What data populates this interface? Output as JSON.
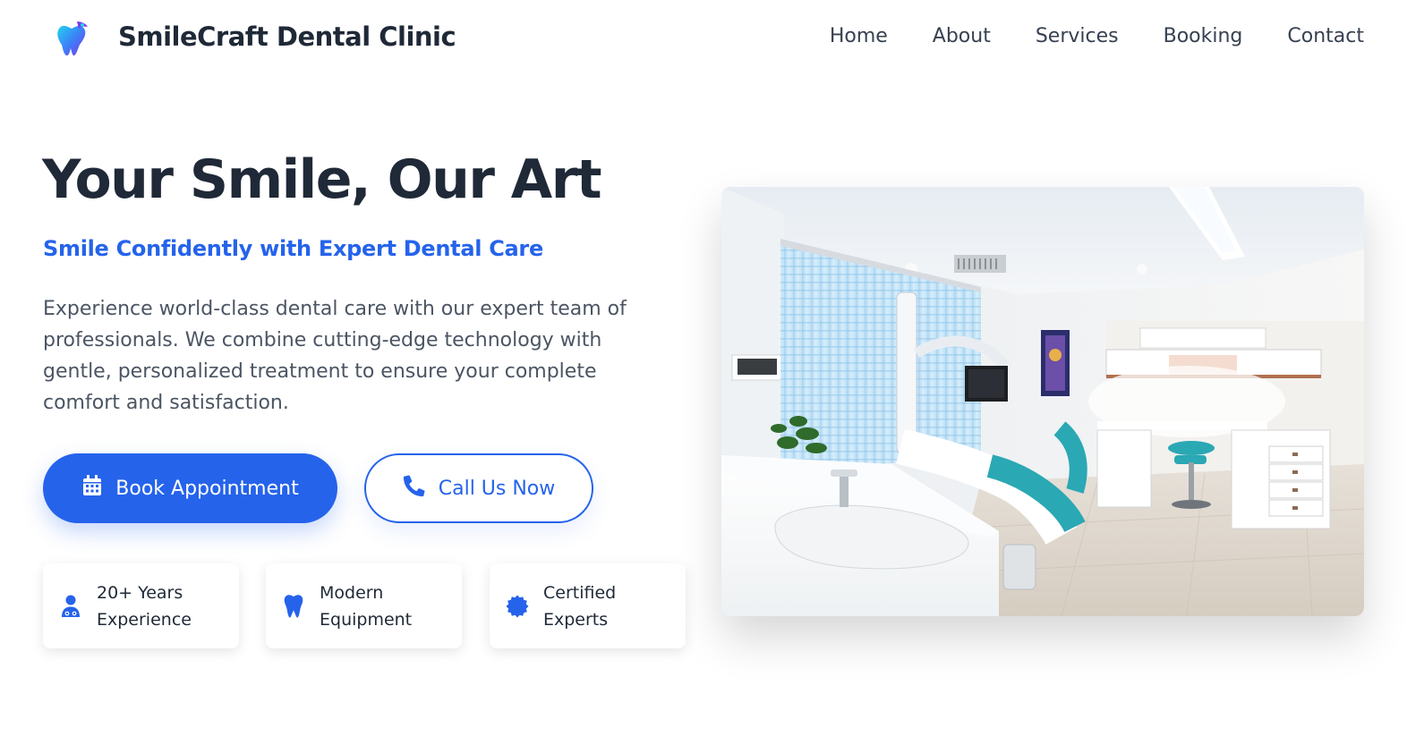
{
  "brand": {
    "name": "SmileCraft Dental Clinic",
    "logo_icon": "tooth-logo-icon"
  },
  "nav": {
    "items": [
      {
        "label": "Home"
      },
      {
        "label": "About"
      },
      {
        "label": "Services"
      },
      {
        "label": "Booking"
      },
      {
        "label": "Contact"
      }
    ]
  },
  "hero": {
    "title": "Your Smile, Our Art",
    "subtitle": "Smile Confidently with Expert Dental Care",
    "description": "Experience world-class dental care with our expert team of professionals. We combine cutting-edge technology with gentle, personalized treatment to ensure your complete comfort and satisfaction.",
    "primary_button": {
      "label": "Book Appointment",
      "icon": "calendar-icon"
    },
    "secondary_button": {
      "label": "Call Us Now",
      "icon": "phone-icon"
    }
  },
  "features": [
    {
      "line1": "20+ Years",
      "line2": "Experience",
      "icon": "user-doctor-icon"
    },
    {
      "line1": "Modern",
      "line2": "Equipment",
      "icon": "tooth-icon"
    },
    {
      "line1": "Certified",
      "line2": "Experts",
      "icon": "certificate-icon"
    }
  ],
  "colors": {
    "accent": "#2563eb",
    "heading": "#1f2937",
    "body_text": "#4b5563"
  },
  "image": {
    "subject": "dental-clinic-room-photo"
  }
}
